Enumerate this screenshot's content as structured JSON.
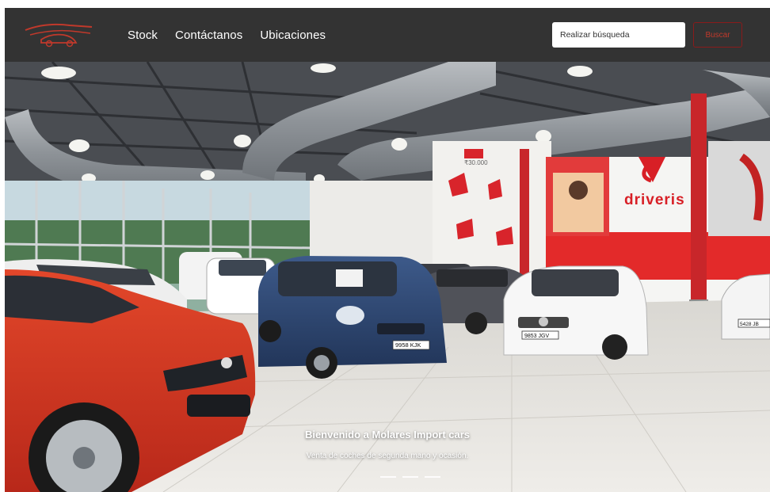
{
  "navbar": {
    "nav_items": [
      {
        "label": "Stock"
      },
      {
        "label": "Contáctanos"
      },
      {
        "label": "Ubicaciones"
      }
    ],
    "search": {
      "placeholder": "Realizar búsqueda"
    },
    "search_button_label": "Buscar"
  },
  "hero": {
    "title": "Bienvenido a Molares Import cars",
    "subtitle": "Venta de coches de segunda mano y ocasión.",
    "brand_sign": "driveris",
    "price_sign": "₹30.000",
    "plates": [
      "9958 KJK",
      "9853 JGV",
      "5428 JB"
    ],
    "slide_count": 3,
    "active_slide": 1
  },
  "colors": {
    "navbar_bg": "#333333",
    "accent_red": "#c0392b",
    "brand_red": "#d81f26"
  }
}
